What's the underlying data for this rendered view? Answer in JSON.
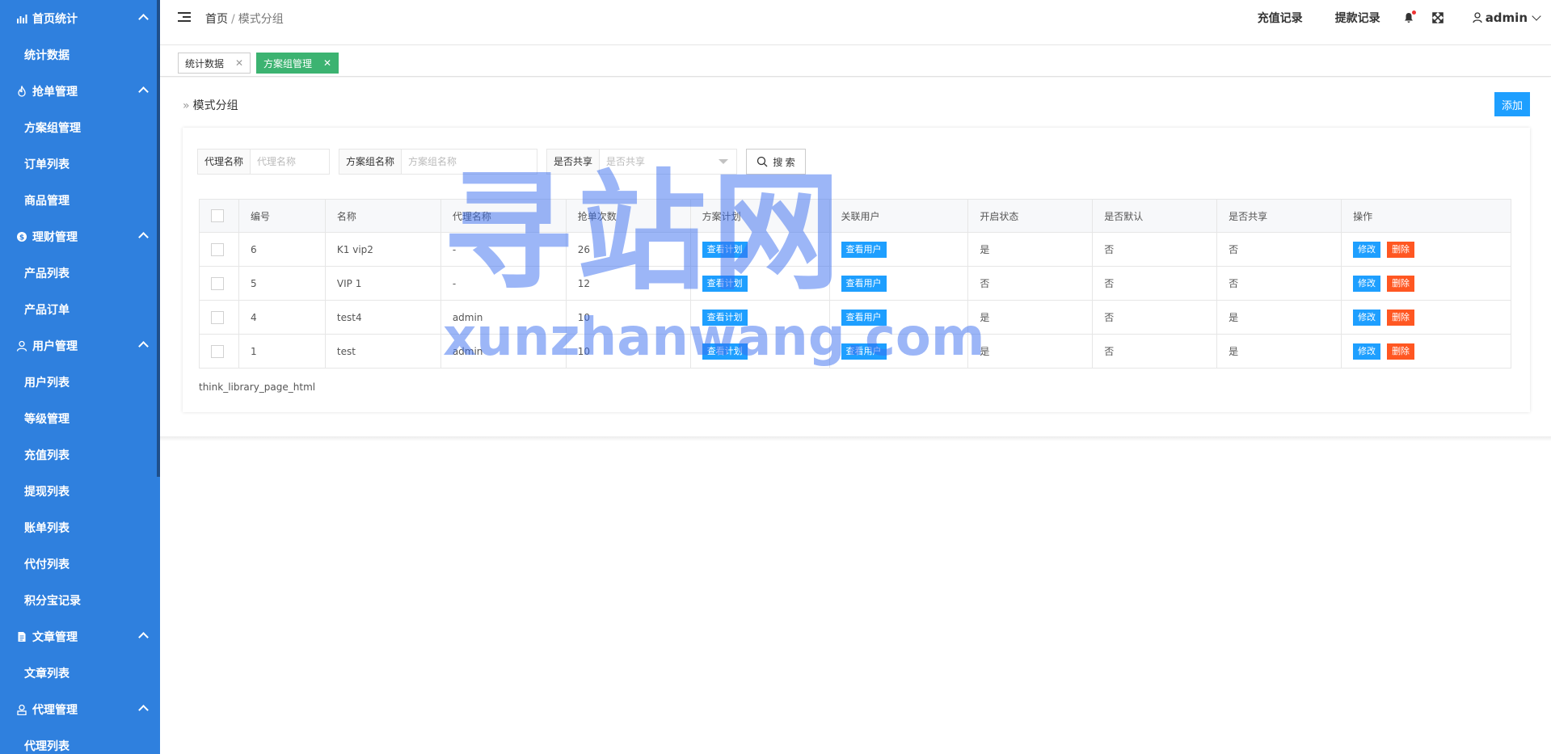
{
  "sidebar": {
    "groups": [
      {
        "label": "首页统计",
        "icon": "bar-chart-icon",
        "items": [
          "统计数据"
        ]
      },
      {
        "label": "抢单管理",
        "icon": "fire-icon",
        "items": [
          "方案组管理",
          "订单列表",
          "商品管理"
        ]
      },
      {
        "label": "理财管理",
        "icon": "coin-icon",
        "items": [
          "产品列表",
          "产品订单"
        ]
      },
      {
        "label": "用户管理",
        "icon": "user-icon",
        "items": [
          "用户列表",
          "等级管理",
          "充值列表",
          "提现列表",
          "账单列表",
          "代付列表",
          "积分宝记录"
        ]
      },
      {
        "label": "文章管理",
        "icon": "document-icon",
        "items": [
          "文章列表"
        ]
      },
      {
        "label": "代理管理",
        "icon": "agent-icon",
        "items": [
          "代理列表"
        ]
      }
    ]
  },
  "header": {
    "breadcrumb_home": "首页",
    "breadcrumb_sep": "/",
    "breadcrumb_current": "模式分组",
    "recharge_link": "充值记录",
    "withdraw_link": "提款记录",
    "user_name": "admin"
  },
  "tabs": [
    {
      "label": "统计数据",
      "active": false
    },
    {
      "label": "方案组管理",
      "active": true
    }
  ],
  "panel": {
    "title": "模式分组",
    "add_label": "添加"
  },
  "filters": {
    "agent_label": "代理名称",
    "agent_placeholder": "代理名称",
    "group_label": "方案组名称",
    "group_placeholder": "方案组名称",
    "share_label": "是否共享",
    "share_placeholder": "是否共享",
    "search_label": "搜 索"
  },
  "table": {
    "headers": [
      "编号",
      "名称",
      "代理名称",
      "抢单次数",
      "方案计划",
      "关联用户",
      "开启状态",
      "是否默认",
      "是否共享",
      "操作"
    ],
    "view_plan_label": "查看计划",
    "view_users_label": "查看用户",
    "edit_label": "修改",
    "delete_label": "删除",
    "rows": [
      {
        "id": "6",
        "name": "K1 vip2",
        "agent": "-",
        "count": "26",
        "status": "是",
        "default": "否",
        "shared": "否"
      },
      {
        "id": "5",
        "name": "VIP 1",
        "agent": "-",
        "count": "12",
        "status": "否",
        "default": "否",
        "shared": "否"
      },
      {
        "id": "4",
        "name": "test4",
        "agent": "admin",
        "count": "10",
        "status": "是",
        "default": "否",
        "shared": "是"
      },
      {
        "id": "1",
        "name": "test",
        "agent": "admin",
        "count": "10",
        "status": "是",
        "default": "否",
        "shared": "是"
      }
    ]
  },
  "pager_text": "think_library_page_html",
  "watermark": {
    "cn": "寻站网",
    "en": "xunzhanwang.com"
  },
  "colors": {
    "sidebar_bg": "#2f80de",
    "primary": "#1e9fff",
    "danger": "#ff5722",
    "tab_active": "#3cb371"
  }
}
